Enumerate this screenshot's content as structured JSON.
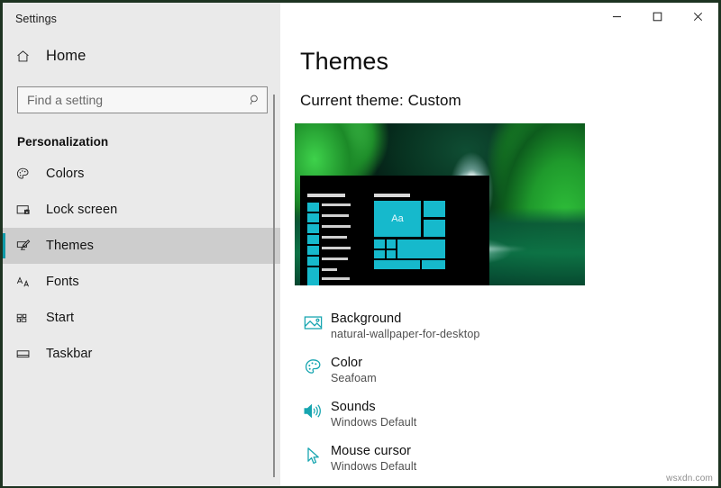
{
  "theme": {
    "accent": "#0f9aa8",
    "teal": "#17a5b0",
    "tile": "#16b9cc"
  },
  "window": {
    "app_title": "Settings",
    "controls": [
      {
        "name": "minimize",
        "glyph": "─"
      },
      {
        "name": "maximize",
        "glyph": "□"
      },
      {
        "name": "close",
        "glyph": "✕"
      }
    ]
  },
  "sidebar": {
    "home_label": "Home",
    "home_icon": "home-icon",
    "search": {
      "placeholder": "Find a setting",
      "value": "",
      "icon": "search-icon"
    },
    "section_title": "Personalization",
    "items": [
      {
        "label": "Colors",
        "icon": "palette-icon",
        "selected": false
      },
      {
        "label": "Lock screen",
        "icon": "monitor-lock-icon",
        "selected": false
      },
      {
        "label": "Themes",
        "icon": "brush-monitor-icon",
        "selected": true
      },
      {
        "label": "Fonts",
        "icon": "font-aa-icon",
        "selected": false
      },
      {
        "label": "Start",
        "icon": "start-tiles-icon",
        "selected": false
      },
      {
        "label": "Taskbar",
        "icon": "taskbar-icon",
        "selected": false
      }
    ]
  },
  "main": {
    "page_title": "Themes",
    "current_theme_text": "Current theme: Custom",
    "preview": {
      "name": "theme-preview-image",
      "description": "Waterfall nature wallpaper with dark Start menu mockup",
      "tile_text": "Aa"
    },
    "settings": [
      {
        "name": "Background",
        "value": "natural-wallpaper-for-desktop",
        "icon": "picture-icon"
      },
      {
        "name": "Color",
        "value": "Seafoam",
        "icon": "palette-icon"
      },
      {
        "name": "Sounds",
        "value": "Windows Default",
        "icon": "speaker-icon"
      },
      {
        "name": "Mouse cursor",
        "value": "Windows Default",
        "icon": "cursor-icon"
      }
    ]
  },
  "watermark": "wsxdn.com"
}
